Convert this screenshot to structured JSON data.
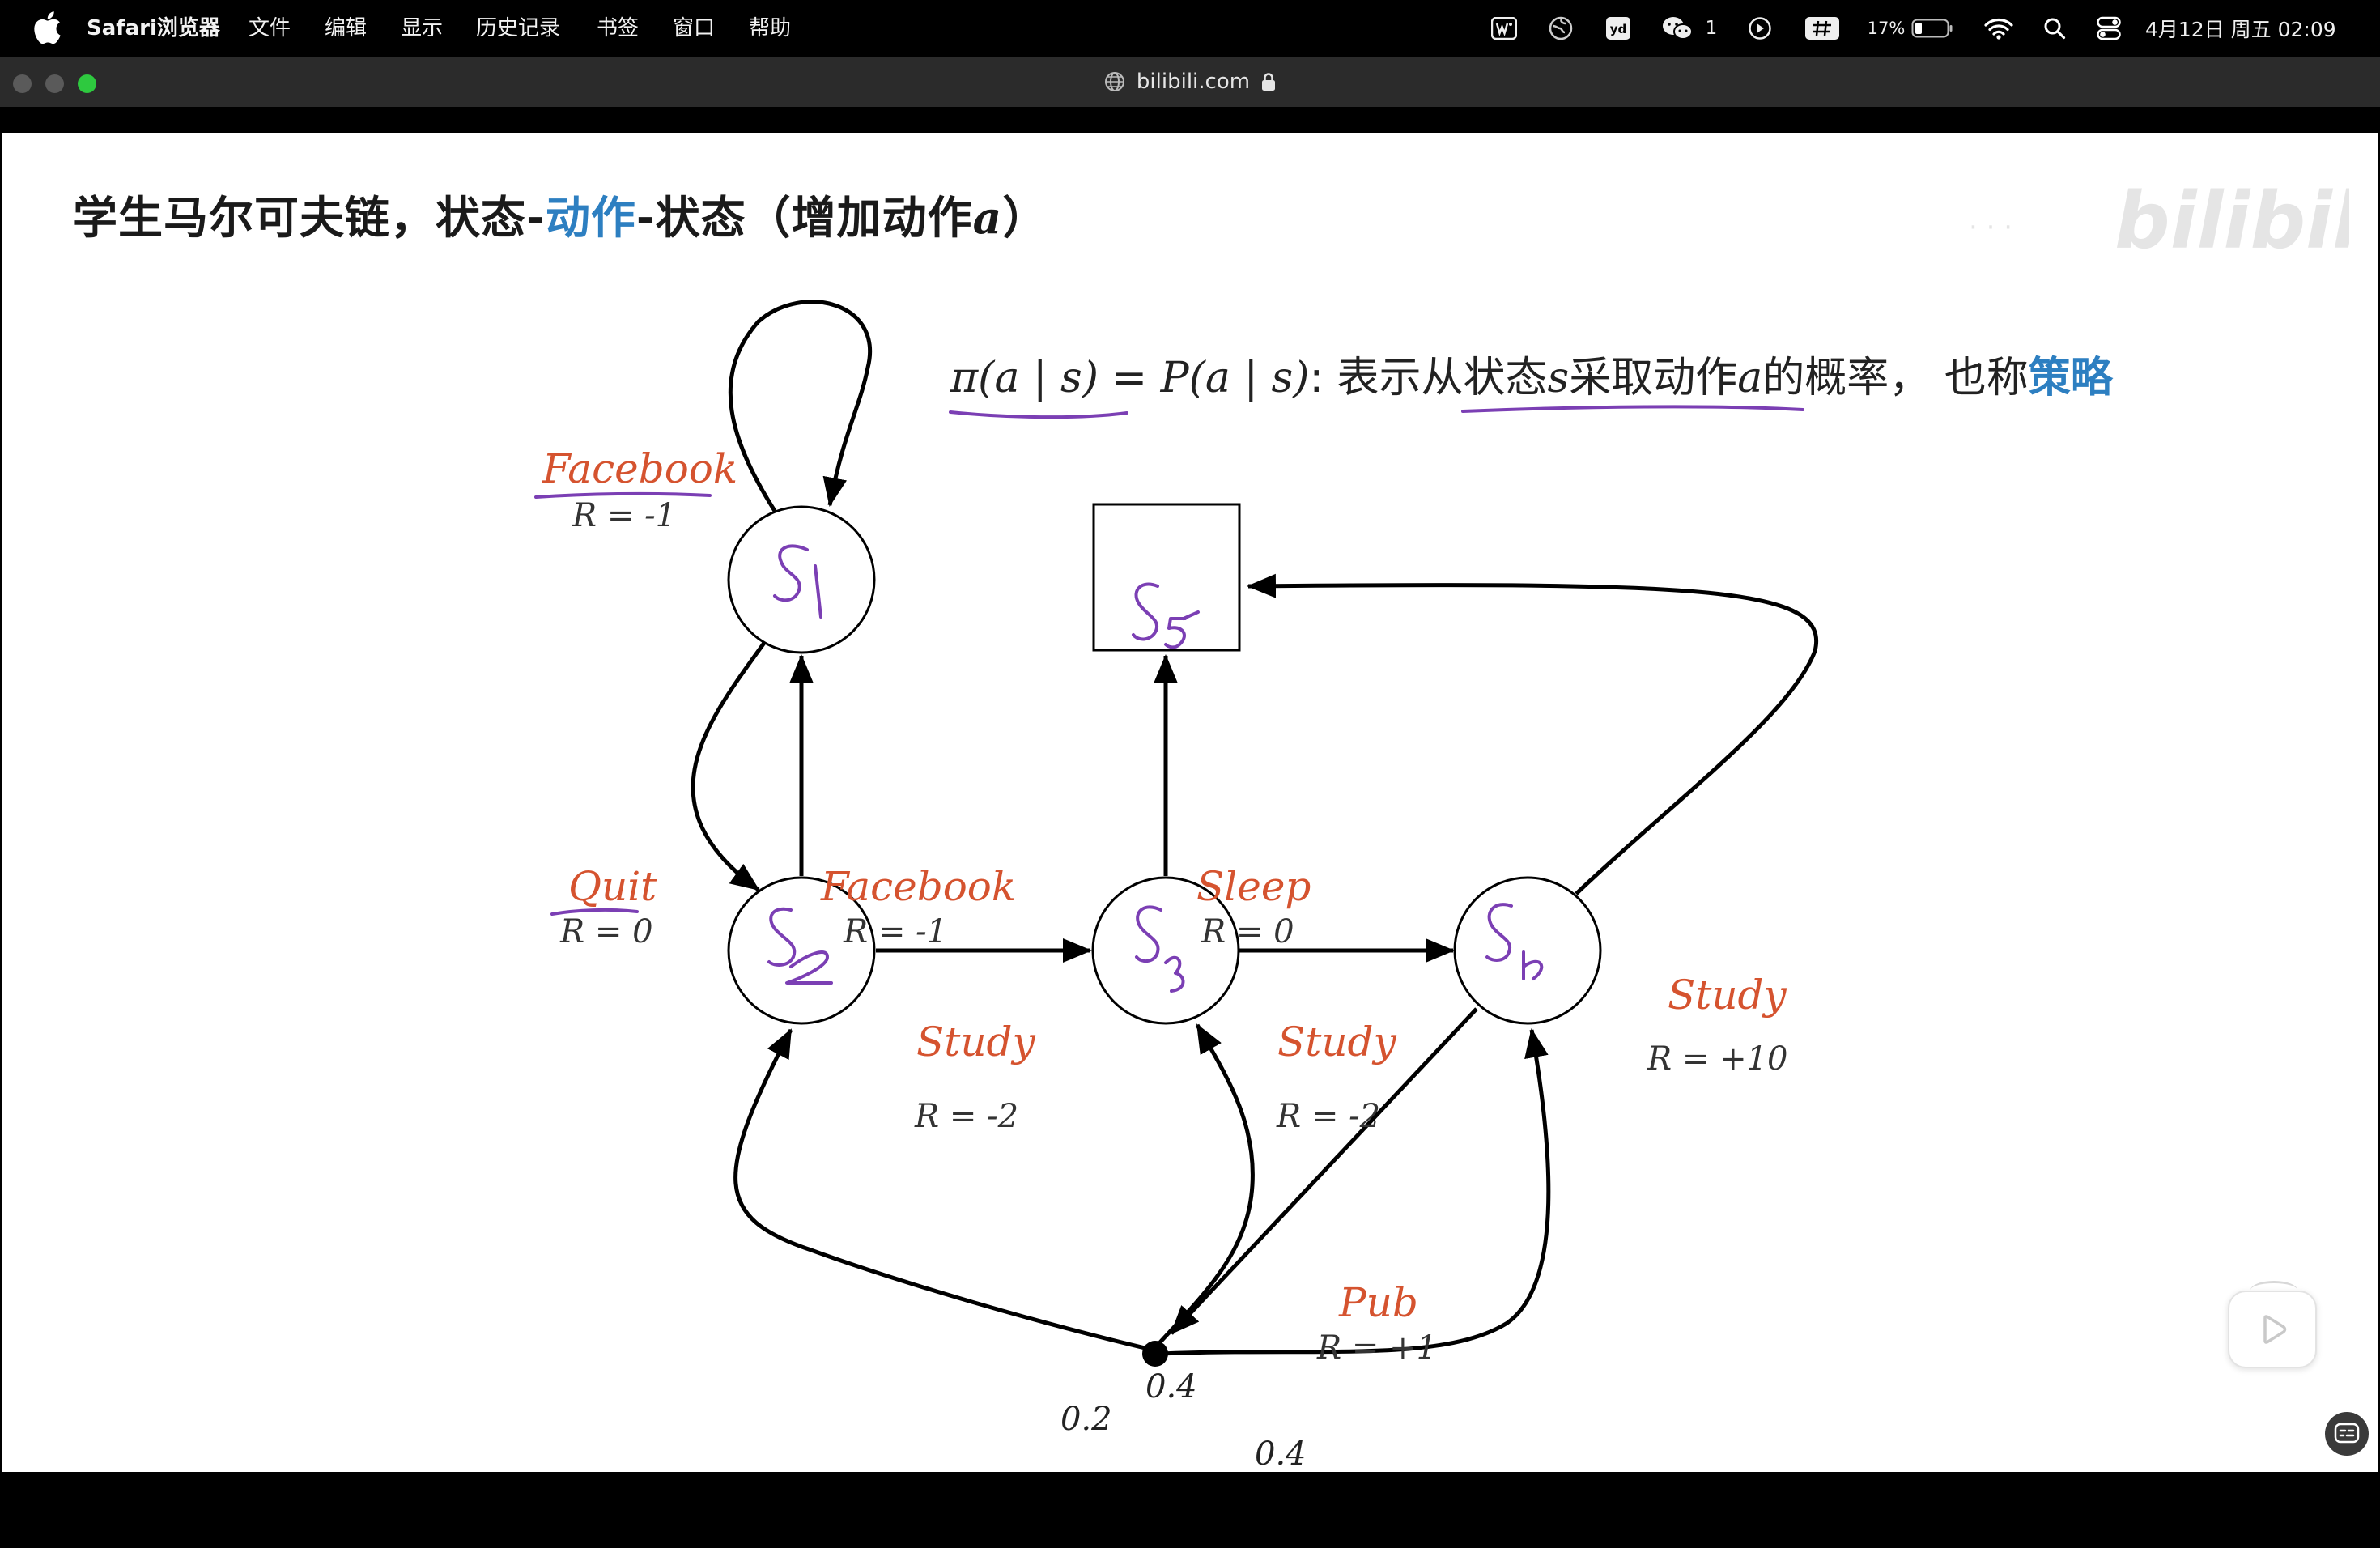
{
  "menubar": {
    "app_name": "Safari浏览器",
    "menus": [
      "文件",
      "编辑",
      "显示",
      "历史记录",
      "书签",
      "窗口",
      "帮助"
    ],
    "status": {
      "wechat_count": "1",
      "battery": "17%",
      "datetime": "4月12日 周五 02:09"
    },
    "icons": [
      "apple-icon",
      "wps-icon",
      "vpn-globe-icon",
      "youdao-icon",
      "wechat-icon",
      "play-circle-icon",
      "input-method-icon",
      "battery-icon",
      "wifi-icon",
      "spotlight-search-icon",
      "control-center-icon"
    ]
  },
  "toolbar": {
    "url": "bilibili.com",
    "icons": [
      "globe-icon",
      "lock-icon"
    ]
  },
  "slide": {
    "title_part1": "学生马尔可夫链，状态-",
    "title_highlight": "动作",
    "title_part2": "-状态（增加动作",
    "title_var": "a",
    "title_end": "）",
    "policy_formula": "π(a | s) = P(a | s)",
    "policy_colon": ":",
    "policy_text1": " 表示从状态",
    "policy_var_s": "s",
    "policy_text2": "采取动作",
    "policy_var_a": "a",
    "policy_text3": "的概率， 也称",
    "policy_highlight": "策略",
    "watermark": "bilibili"
  },
  "diagram": {
    "states": [
      "S1",
      "S2",
      "S3",
      "S4",
      "S5"
    ],
    "labels": {
      "s1_facebook": "Facebook",
      "s1_facebook_r": "R = -1",
      "quit": "Quit",
      "quit_r": "R = 0",
      "s2_facebook": "Facebook",
      "s2_facebook_r": "R = -1",
      "sleep": "Sleep",
      "sleep_r": "R = 0",
      "s2_study": "Study",
      "s2_study_r": "R = -2",
      "s3_study": "Study",
      "s3_study_r": "R = -2",
      "s4_study": "Study",
      "s4_study_r": "R = +10",
      "pub": "Pub",
      "pub_r": "R = +1"
    },
    "probabilities": {
      "to_s2": "0.2",
      "to_s3": "0.4",
      "to_s4": "0.4"
    },
    "colors": {
      "action_label": "#d5532f",
      "handwriting": "#7b3fb4",
      "highlight": "#2d7fc1"
    }
  },
  "player": {
    "icons": [
      "play-icon",
      "subtitle-icon"
    ]
  }
}
